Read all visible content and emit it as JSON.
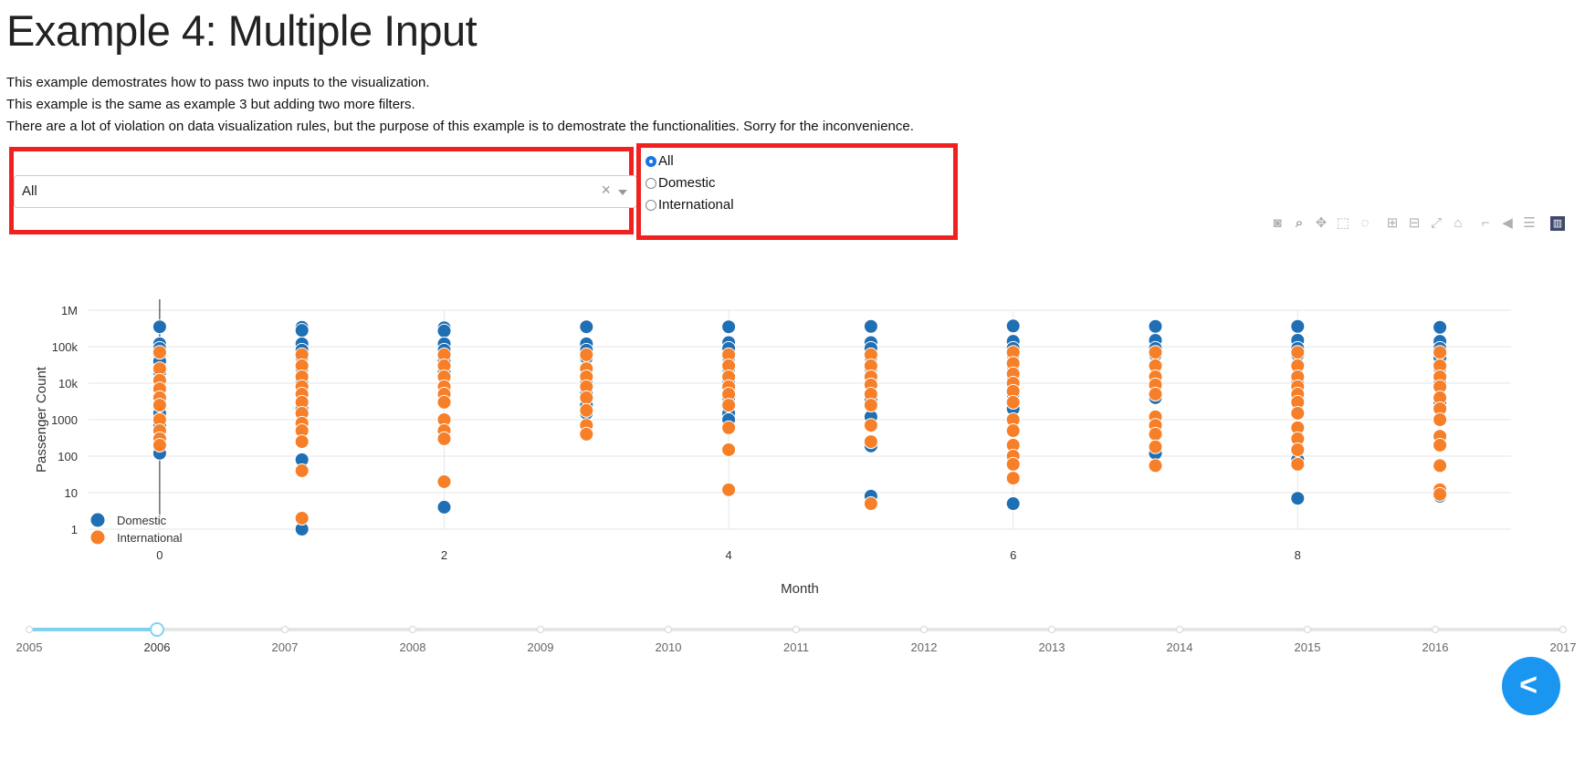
{
  "page": {
    "title": "Example 4: Multiple Input",
    "desc1": "This example demostrates how to pass two inputs to the visualization.",
    "desc2": "This example is the same as example 3 but adding two more filters.",
    "desc3": "There are a lot of violation on data visualization rules, but the purpose of this example is to demostrate the functionalities. Sorry for the inconvenience."
  },
  "dropdown": {
    "value": "All",
    "clear_icon": "×"
  },
  "radio": {
    "options": [
      {
        "label": "All",
        "checked": true
      },
      {
        "label": "Domestic",
        "checked": false
      },
      {
        "label": "International",
        "checked": false
      }
    ]
  },
  "modebar_icons": [
    "camera-icon",
    "zoom-icon",
    "pan-icon",
    "box-select-icon",
    "lasso-icon",
    "zoom-in-icon",
    "zoom-out-icon",
    "autoscale-icon",
    "reset-axes-icon",
    "spike-lines-icon",
    "hover-closest-icon",
    "hover-compare-icon",
    "plotly-logo-icon"
  ],
  "chart_data": {
    "type": "scatter",
    "xlabel": "Month",
    "ylabel": "Passenger Count",
    "yscale": "log",
    "xlim": [
      -0.5,
      9.5
    ],
    "ylim": [
      1,
      1000000
    ],
    "x_ticks": [
      0,
      2,
      4,
      6,
      8
    ],
    "y_ticks": [
      {
        "v": 1,
        "label": "1"
      },
      {
        "v": 10,
        "label": "10"
      },
      {
        "v": 100,
        "label": "100"
      },
      {
        "v": 1000,
        "label": "1000"
      },
      {
        "v": 10000,
        "label": "10k"
      },
      {
        "v": 100000,
        "label": "100k"
      },
      {
        "v": 1000000,
        "label": "1M"
      }
    ],
    "grid": true,
    "legend_position": "bottom-left",
    "series": [
      {
        "name": "Domestic",
        "color": "#1f6fb4",
        "points": [
          [
            0,
            350000
          ],
          [
            0,
            120000
          ],
          [
            0,
            90000
          ],
          [
            0,
            60000
          ],
          [
            0,
            40000
          ],
          [
            0,
            20000
          ],
          [
            0,
            8000
          ],
          [
            0,
            3000
          ],
          [
            0,
            1500
          ],
          [
            0,
            700
          ],
          [
            0,
            120
          ],
          [
            1,
            340000
          ],
          [
            1,
            280000
          ],
          [
            1,
            120000
          ],
          [
            1,
            80000
          ],
          [
            1,
            50000
          ],
          [
            1,
            25000
          ],
          [
            1,
            10000
          ],
          [
            1,
            5000
          ],
          [
            1,
            2000
          ],
          [
            1,
            600
          ],
          [
            1,
            80
          ],
          [
            1,
            1
          ],
          [
            2,
            330000
          ],
          [
            2,
            270000
          ],
          [
            2,
            120000
          ],
          [
            2,
            80000
          ],
          [
            2,
            40000
          ],
          [
            2,
            20000
          ],
          [
            2,
            8000
          ],
          [
            2,
            3000
          ],
          [
            2,
            4
          ],
          [
            3,
            350000
          ],
          [
            3,
            120000
          ],
          [
            3,
            80000
          ],
          [
            3,
            50000
          ],
          [
            3,
            25000
          ],
          [
            3,
            10000
          ],
          [
            3,
            5000
          ],
          [
            3,
            2500
          ],
          [
            3,
            1500
          ],
          [
            4,
            350000
          ],
          [
            4,
            130000
          ],
          [
            4,
            90000
          ],
          [
            4,
            50000
          ],
          [
            4,
            25000
          ],
          [
            4,
            10000
          ],
          [
            4,
            4000
          ],
          [
            4,
            1500
          ],
          [
            4,
            1000
          ],
          [
            5,
            360000
          ],
          [
            5,
            130000
          ],
          [
            5,
            90000
          ],
          [
            5,
            50000
          ],
          [
            5,
            25000
          ],
          [
            5,
            10000
          ],
          [
            5,
            3500
          ],
          [
            5,
            1200
          ],
          [
            5,
            190
          ],
          [
            5,
            8
          ],
          [
            6,
            370000
          ],
          [
            6,
            140000
          ],
          [
            6,
            90000
          ],
          [
            6,
            60000
          ],
          [
            6,
            30000
          ],
          [
            6,
            12000
          ],
          [
            6,
            5000
          ],
          [
            6,
            2000
          ],
          [
            6,
            5
          ],
          [
            7,
            360000
          ],
          [
            7,
            150000
          ],
          [
            7,
            90000
          ],
          [
            7,
            60000
          ],
          [
            7,
            30000
          ],
          [
            7,
            12000
          ],
          [
            7,
            4000
          ],
          [
            7,
            120
          ],
          [
            8,
            360000
          ],
          [
            8,
            150000
          ],
          [
            8,
            90000
          ],
          [
            8,
            60000
          ],
          [
            8,
            30000
          ],
          [
            8,
            10000
          ],
          [
            8,
            4000
          ],
          [
            8,
            80
          ],
          [
            8,
            7
          ],
          [
            9,
            340000
          ],
          [
            9,
            140000
          ],
          [
            9,
            90000
          ],
          [
            9,
            50000
          ],
          [
            9,
            25000
          ],
          [
            9,
            10000
          ],
          [
            9,
            3000
          ],
          [
            9,
            8
          ]
        ]
      },
      {
        "name": "International",
        "color": "#f77f28",
        "points": [
          [
            0,
            70000
          ],
          [
            0,
            25000
          ],
          [
            0,
            12000
          ],
          [
            0,
            7000
          ],
          [
            0,
            4000
          ],
          [
            0,
            2500
          ],
          [
            0,
            1000
          ],
          [
            0,
            500
          ],
          [
            0,
            300
          ],
          [
            0,
            200
          ],
          [
            1,
            60000
          ],
          [
            1,
            30000
          ],
          [
            1,
            15000
          ],
          [
            1,
            8000
          ],
          [
            1,
            5000
          ],
          [
            1,
            3000
          ],
          [
            1,
            1500
          ],
          [
            1,
            800
          ],
          [
            1,
            500
          ],
          [
            1,
            250
          ],
          [
            1,
            40
          ],
          [
            1,
            2
          ],
          [
            2,
            60000
          ],
          [
            2,
            30000
          ],
          [
            2,
            15000
          ],
          [
            2,
            8000
          ],
          [
            2,
            5000
          ],
          [
            2,
            3000
          ],
          [
            2,
            1000
          ],
          [
            2,
            500
          ],
          [
            2,
            300
          ],
          [
            2,
            20
          ],
          [
            3,
            60000
          ],
          [
            3,
            25000
          ],
          [
            3,
            15000
          ],
          [
            3,
            8000
          ],
          [
            3,
            4000
          ],
          [
            3,
            1800
          ],
          [
            3,
            700
          ],
          [
            3,
            400
          ],
          [
            4,
            60000
          ],
          [
            4,
            30000
          ],
          [
            4,
            15000
          ],
          [
            4,
            8000
          ],
          [
            4,
            5000
          ],
          [
            4,
            2500
          ],
          [
            4,
            600
          ],
          [
            4,
            150
          ],
          [
            4,
            12
          ],
          [
            5,
            60000
          ],
          [
            5,
            30000
          ],
          [
            5,
            15000
          ],
          [
            5,
            9000
          ],
          [
            5,
            5000
          ],
          [
            5,
            2500
          ],
          [
            5,
            700
          ],
          [
            5,
            250
          ],
          [
            5,
            5
          ],
          [
            6,
            70000
          ],
          [
            6,
            35000
          ],
          [
            6,
            18000
          ],
          [
            6,
            10000
          ],
          [
            6,
            6000
          ],
          [
            6,
            3000
          ],
          [
            6,
            1000
          ],
          [
            6,
            500
          ],
          [
            6,
            200
          ],
          [
            6,
            100
          ],
          [
            6,
            60
          ],
          [
            6,
            25
          ],
          [
            7,
            70000
          ],
          [
            7,
            30000
          ],
          [
            7,
            15000
          ],
          [
            7,
            9000
          ],
          [
            7,
            5000
          ],
          [
            7,
            1200
          ],
          [
            7,
            700
          ],
          [
            7,
            400
          ],
          [
            7,
            180
          ],
          [
            7,
            55
          ],
          [
            8,
            70000
          ],
          [
            8,
            30000
          ],
          [
            8,
            15000
          ],
          [
            8,
            8000
          ],
          [
            8,
            5000
          ],
          [
            8,
            3000
          ],
          [
            8,
            1500
          ],
          [
            8,
            600
          ],
          [
            8,
            300
          ],
          [
            8,
            150
          ],
          [
            8,
            60
          ],
          [
            9,
            70000
          ],
          [
            9,
            30000
          ],
          [
            9,
            15000
          ],
          [
            9,
            8000
          ],
          [
            9,
            4000
          ],
          [
            9,
            2000
          ],
          [
            9,
            1000
          ],
          [
            9,
            350
          ],
          [
            9,
            200
          ],
          [
            9,
            55
          ],
          [
            9,
            12
          ],
          [
            9,
            9
          ]
        ]
      }
    ]
  },
  "slider": {
    "years": [
      "2005",
      "2006",
      "2007",
      "2008",
      "2009",
      "2010",
      "2011",
      "2012",
      "2013",
      "2014",
      "2015",
      "2016",
      "2017"
    ],
    "selected": "2006"
  },
  "code_button": {
    "label": "< >"
  }
}
